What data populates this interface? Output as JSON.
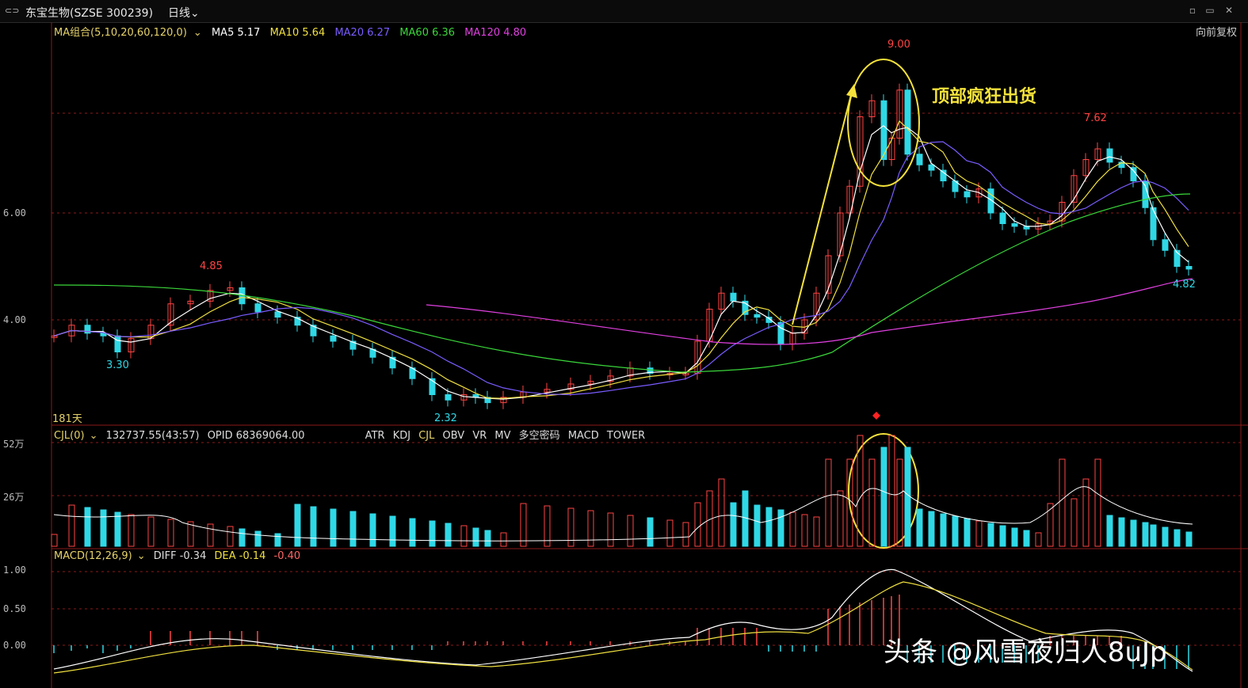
{
  "topbar": {
    "stock_name": "东宝生物(SZSE 300239)",
    "period": "日线",
    "chevron": "chevron-down-icon",
    "window_icon": "link-icon"
  },
  "ma_legend": {
    "group": "MA组合(5,10,20,60,120,0)",
    "ma5": "MA5 5.17",
    "ma10": "MA10 5.64",
    "ma20": "MA20 6.27",
    "ma60": "MA60 6.36",
    "ma120": "MA120 4.80",
    "adjust": "向前复权",
    "colors": {
      "ma5": "#ffffff",
      "ma10": "#f0e040",
      "ma20": "#7a5cff",
      "ma60": "#3ad63a",
      "ma120": "#e040e0"
    }
  },
  "price_axis": {
    "labels": [
      "6.00",
      "4.00"
    ]
  },
  "days_label": "181天",
  "annotation": "顶部疯狂出货",
  "price_marks": {
    "high": "9.00",
    "h2": "7.62",
    "h3": "4.85",
    "low1": "3.30",
    "low2": "2.32",
    "last": "4.82"
  },
  "volume_panel": {
    "title": "CJL(0)",
    "values": "132737.55(43:57)",
    "opid": "OPID 68369064.00",
    "tabs": [
      "ATR",
      "KDJ",
      "CJL",
      "OBV",
      "VR",
      "MV",
      "多空密码",
      "MACD",
      "TOWER"
    ],
    "active_tab": "CJL",
    "axis": [
      "52万",
      "26万"
    ]
  },
  "macd_panel": {
    "title": "MACD(12,26,9)",
    "diff": "DIFF -0.34",
    "dea": "DEA -0.14",
    "macd": "-0.40",
    "axis": [
      "1.00",
      "0.50",
      "0.00"
    ]
  },
  "watermark": "头条 @风雪夜归人8uJp",
  "colors": {
    "up": "#ff4444",
    "down": "#2fd8e6",
    "grid": "#8b1a1a",
    "text_yellow": "#e6d36a"
  }
}
